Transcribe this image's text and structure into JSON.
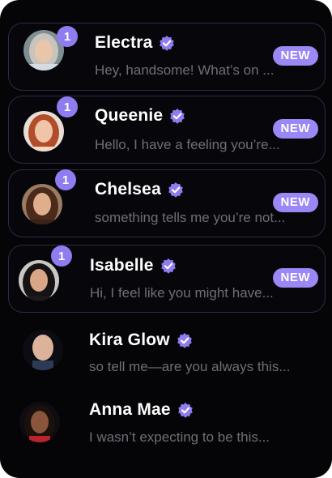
{
  "colors": {
    "accent": "#8e7cf0",
    "badge": "#9b87f5",
    "background": "#050507",
    "border": "#2c2a48",
    "preview_text": "#6e6e78"
  },
  "chats": [
    {
      "name": "Electra",
      "preview": "Hey, handsome! What’s on ...",
      "unread": "1",
      "badge": "NEW",
      "verified_icon": "verified-check-icon"
    },
    {
      "name": "Queenie",
      "preview": "Hello, I have a feeling you’re...",
      "unread": "1",
      "badge": "NEW",
      "verified_icon": "verified-check-icon"
    },
    {
      "name": "Chelsea",
      "preview": "something tells me you’re not...",
      "unread": "1",
      "badge": "NEW",
      "verified_icon": "verified-check-icon"
    },
    {
      "name": "Isabelle",
      "preview": "Hi, I feel like you might have...",
      "unread": "1",
      "badge": "NEW",
      "verified_icon": "verified-check-icon"
    },
    {
      "name": "Kira Glow",
      "preview": "so tell me—are you always this...",
      "verified_icon": "verified-check-icon"
    },
    {
      "name": "Anna Mae",
      "preview": "I wasn’t expecting to be this...",
      "verified_icon": "verified-check-icon"
    }
  ]
}
